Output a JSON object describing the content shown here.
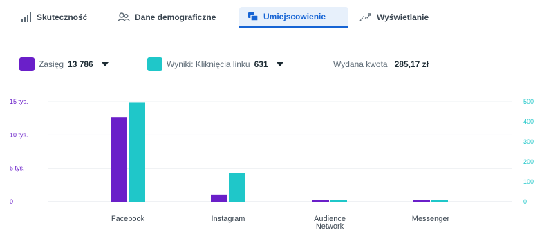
{
  "tabs": [
    {
      "label": "Skuteczność",
      "icon": "bar-chart-icon",
      "active": false
    },
    {
      "label": "Dane demograficzne",
      "icon": "people-icon",
      "active": false
    },
    {
      "label": "Umiejscowienie",
      "icon": "placement-icon",
      "active": true
    },
    {
      "label": "Wyświetlanie",
      "icon": "delivery-icon",
      "active": false
    }
  ],
  "legend": {
    "reach": {
      "label": "Zasięg",
      "value": "13 786",
      "color": "#6a1fc9"
    },
    "results": {
      "label": "Wyniki: Kliknięcia linku",
      "value": "631",
      "color": "#1fc7c9"
    },
    "spend": {
      "label": "Wydana kwota",
      "value": "285,17 zł"
    }
  },
  "chart_data": {
    "type": "bar",
    "categories": [
      "Facebook",
      "Instagram",
      "Audience Network",
      "Messenger"
    ],
    "series": [
      {
        "name": "Zasięg",
        "axis": "left",
        "color": "#6a1fc9",
        "values": [
          12600,
          1050,
          70,
          70
        ]
      },
      {
        "name": "Wyniki: Kliknięcia linku",
        "axis": "right",
        "color": "#1fc7c9",
        "values": [
          495,
          142,
          4,
          4
        ]
      }
    ],
    "left_axis": {
      "ylim": [
        0,
        15000
      ],
      "ticks": [
        0,
        5000,
        10000,
        15000
      ],
      "tick_labels": [
        "0",
        "5 tys.",
        "10 tys.",
        "15 tys."
      ],
      "color": "#6a1fc9"
    },
    "right_axis": {
      "ylim": [
        0,
        500
      ],
      "ticks": [
        0,
        100,
        200,
        300,
        400,
        500
      ],
      "tick_labels": [
        "0",
        "100",
        "200",
        "300",
        "400",
        "500"
      ],
      "color": "#1fc7c9"
    },
    "grid": true,
    "legend": "top-left"
  }
}
